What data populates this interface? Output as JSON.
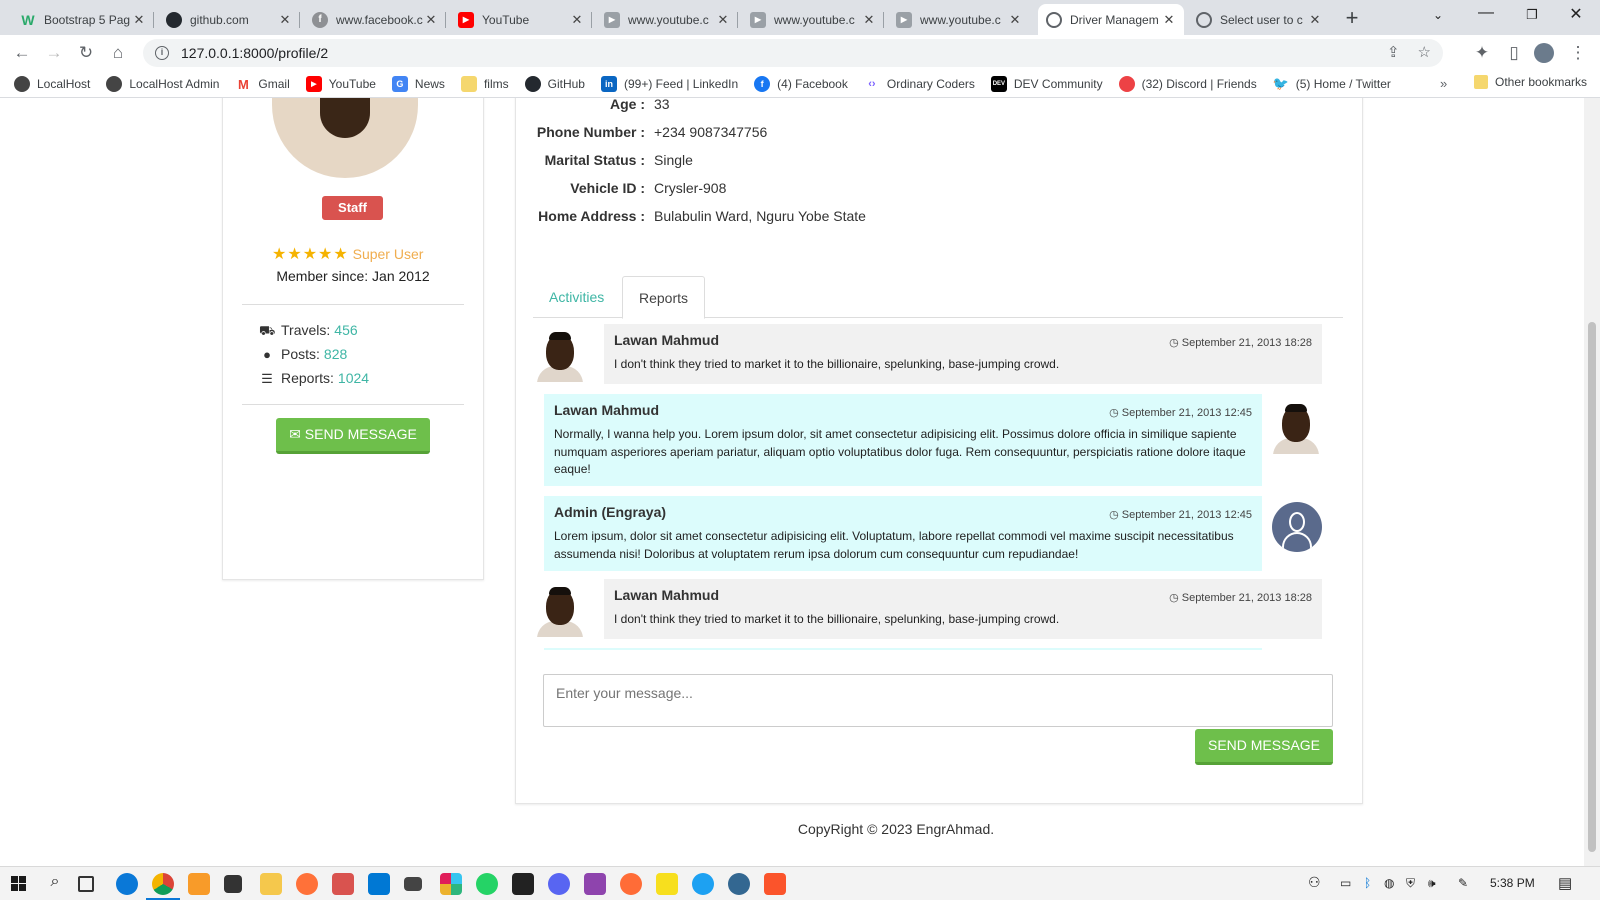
{
  "browser": {
    "tabs": [
      {
        "title": "Bootstrap 5 Pag",
        "icon": "w-icon",
        "color": "#2aa96a",
        "glyph": "W",
        "active": false
      },
      {
        "title": "github.com",
        "icon": "github-icon",
        "color": "#24292f",
        "glyph": "",
        "active": false
      },
      {
        "title": "www.facebook.c",
        "icon": "facebook-icon",
        "color": "#8e9094",
        "glyph": "f",
        "active": false
      },
      {
        "title": "YouTube",
        "icon": "youtube-icon",
        "color": "#ff0000",
        "glyph": "▶",
        "active": false
      },
      {
        "title": "www.youtube.c",
        "icon": "youtube-grey-icon",
        "color": "#9aa0a6",
        "glyph": "▶",
        "active": false
      },
      {
        "title": "www.youtube.c",
        "icon": "youtube-grey-icon",
        "color": "#9aa0a6",
        "glyph": "▶",
        "active": false
      },
      {
        "title": "www.youtube.c",
        "icon": "youtube-grey-icon",
        "color": "#9aa0a6",
        "glyph": "▶",
        "active": false
      },
      {
        "title": "Driver Managem",
        "icon": "globe-icon",
        "color": "#5f6368",
        "glyph": "◍",
        "active": true
      },
      {
        "title": "Select user to c",
        "icon": "globe-icon",
        "color": "#5f6368",
        "glyph": "◍",
        "active": false
      }
    ],
    "url": "127.0.0.1:8000/profile/2",
    "bookmarks": [
      {
        "label": "LocalHost",
        "icon": "globe-icon",
        "color": "#444"
      },
      {
        "label": "LocalHost Admin",
        "icon": "globe-icon",
        "color": "#444"
      },
      {
        "label": "Gmail",
        "icon": "gmail-icon",
        "color": "#ea4335"
      },
      {
        "label": "YouTube",
        "icon": "youtube-icon",
        "color": "#ff0000"
      },
      {
        "label": "News",
        "icon": "news-icon",
        "color": "#4285f4"
      },
      {
        "label": "films",
        "icon": "folder-icon",
        "color": "#f5c84c"
      },
      {
        "label": "GitHub",
        "icon": "github-icon",
        "color": "#24292f"
      },
      {
        "label": "(99+) Feed | LinkedIn",
        "icon": "linkedin-icon",
        "color": "#0a66c2"
      },
      {
        "label": "(4) Facebook",
        "icon": "facebook-icon",
        "color": "#1877f2"
      },
      {
        "label": "Ordinary Coders",
        "icon": "code-icon",
        "color": "#7b61ff"
      },
      {
        "label": "DEV Community",
        "icon": "dev-icon",
        "color": "#000000"
      },
      {
        "label": "(32) Discord | Friends",
        "icon": "discord-icon",
        "color": "#ed4245"
      },
      {
        "label": "(5) Home / Twitter",
        "icon": "twitter-icon",
        "color": "#1d9bf0"
      }
    ],
    "other_bookmarks": "Other bookmarks"
  },
  "profile": {
    "badge": "Staff",
    "rating_label": "Super User",
    "stars": "★★★★★",
    "member_since": "Member since: Jan 2012",
    "stats": [
      {
        "label": "Travels:",
        "value": "456",
        "icon": "truck-icon",
        "glyph": "🚚"
      },
      {
        "label": "Posts:",
        "value": "828",
        "icon": "comment-icon",
        "glyph": "💬"
      },
      {
        "label": "Reports:",
        "value": "1024",
        "icon": "list-icon",
        "glyph": "☰"
      }
    ],
    "send_button": "SEND MESSAGE"
  },
  "details": [
    {
      "label": "Age :",
      "value": "33"
    },
    {
      "label": "Phone Number :",
      "value": "+234 9087347756"
    },
    {
      "label": "Marital Status :",
      "value": "Single"
    },
    {
      "label": "Vehicle ID :",
      "value": "Crysler-908"
    },
    {
      "label": "Home Address :",
      "value": "Bulabulin Ward, Nguru Yobe State"
    }
  ],
  "tabs": {
    "activities": "Activities",
    "reports": "Reports"
  },
  "messages": [
    {
      "name": "Lawan Mahmud",
      "time": "September 21, 2013 18:28",
      "text": "I don't think they tried to market it to the billionaire, spelunking, base-jumping crowd.",
      "side": "left"
    },
    {
      "name": "Lawan Mahmud",
      "time": "September 21, 2013 12:45",
      "text": "Normally, I wanna help you. Lorem ipsum dolor, sit amet consectetur adipisicing elit. Possimus dolore officia in similique sapiente numquam asperiores aperiam pariatur, aliquam optio voluptatibus dolor fuga. Rem consequuntur, perspiciatis ratione dolore itaque eaque!",
      "side": "right"
    },
    {
      "name": "Admin (Engraya)",
      "time": "September 21, 2013 12:45",
      "text": "Lorem ipsum, dolor sit amet consectetur adipisicing elit. Voluptatum, labore repellat commodi vel maxime suscipit necessitatibus assumenda nisi! Doloribus at voluptatem rerum ipsa dolorum cum consequuntur cum repudiandae!",
      "side": "right"
    },
    {
      "name": "Lawan Mahmud",
      "time": "September 21, 2013 18:28",
      "text": "I don't think they tried to market it to the billionaire, spelunking, base-jumping crowd.",
      "side": "left"
    }
  ],
  "composer": {
    "placeholder": "Enter your message...",
    "send": "SEND MESSAGE"
  },
  "footer": "CopyRight © 2023 EngrAhmad.",
  "taskbar": {
    "time": "5:38 PM"
  }
}
